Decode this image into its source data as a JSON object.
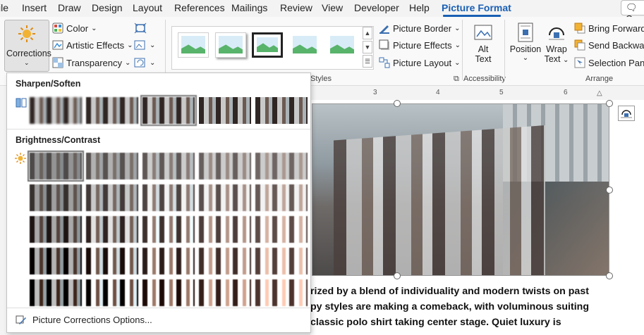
{
  "tabs": {
    "items": [
      "ile",
      "Insert",
      "Draw",
      "Design",
      "Layout",
      "References",
      "Mailings",
      "Review",
      "View",
      "Developer",
      "Help",
      "Picture Format"
    ],
    "active": "Picture Format",
    "comments_label": "Co"
  },
  "ribbon": {
    "adjust": {
      "corrections_label": "Corrections",
      "color_label": "Color",
      "artistic_label": "Artistic Effects",
      "transparency_label": "Transparency"
    },
    "styles": {
      "group_label": "Picture Styles",
      "group_label_visible": "Styles",
      "border_label": "Picture Border",
      "effects_label": "Picture Effects",
      "layout_label": "Picture Layout"
    },
    "accessibility": {
      "alt_text_label_1": "Alt",
      "alt_text_label_2": "Text",
      "group_label": "Accessibility"
    },
    "arrange": {
      "position_label": "Position",
      "wrap_label_1": "Wrap",
      "wrap_label_2": "Text",
      "bring_forward_label": "Bring Forward",
      "send_backward_label": "Send Backward",
      "selection_pane_label": "Selection Pane",
      "group_label": "Arrange"
    }
  },
  "ruler": {
    "marks": [
      "3",
      "4",
      "5",
      "6"
    ]
  },
  "corrections_menu": {
    "sharpen_title": "Sharpen/Soften",
    "brightness_title": "Brightness/Contrast",
    "footer_label": "Picture Corrections Options...",
    "sharpen_count": 5,
    "sharpen_selected_index": 2,
    "brightness_rows": 5,
    "brightness_cols": 5,
    "brightness_selected": [
      0,
      0
    ]
  },
  "document": {
    "lines": [
      "rized by a blend of individuality and modern twists on past",
      "py styles are making a comeback, with voluminous suiting",
      "classic polo shirt taking center stage. Quiet luxury is"
    ]
  },
  "colors": {
    "accent": "#1a5fb4",
    "ribbon_bg": "#f9f9f9",
    "selected_outline": "#8a8a8a"
  }
}
